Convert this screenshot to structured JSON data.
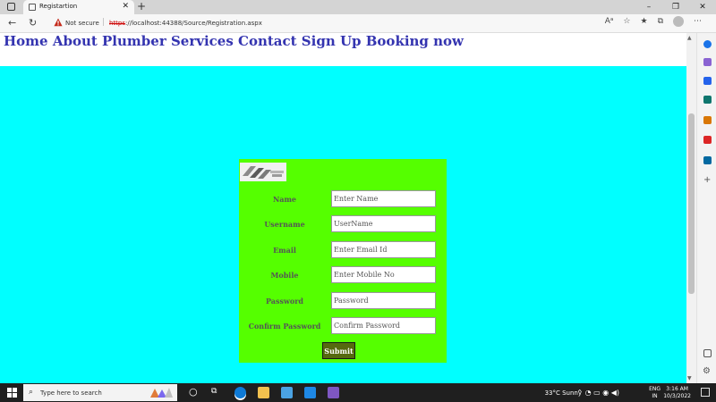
{
  "browser": {
    "tab_title": "Registartion",
    "new_tab_symbol": "+",
    "address": {
      "security_label": "Not secure",
      "protocol": "https",
      "url_rest": "://localhost:44388/Source/Registration.aspx"
    },
    "window_controls": {
      "minimize": "–",
      "maximize": "❐",
      "close": "✕"
    }
  },
  "page": {
    "nav_items": [
      "Home",
      "About",
      "Plumber Services",
      "Contact",
      "Sign Up",
      "Booking now"
    ],
    "form": {
      "fields": [
        {
          "label": "Name",
          "placeholder": "Enter Name"
        },
        {
          "label": "Username",
          "placeholder": "UserName"
        },
        {
          "label": "Email",
          "placeholder": "Enter Email Id"
        },
        {
          "label": "Mobile",
          "placeholder": "Enter Mobile No"
        },
        {
          "label": "Password",
          "placeholder": "Password"
        },
        {
          "label": "Confirm Password",
          "placeholder": "Confirm Password"
        }
      ],
      "submit_label": "Submit"
    }
  },
  "taskbar": {
    "search_placeholder": "Type here to search",
    "weather": "33°C  Sunny",
    "lang_top": "ENG",
    "lang_bottom": "IN",
    "time": "3:16 AM",
    "date": "10/3/2022"
  },
  "colors": {
    "page_background": "#00ffff",
    "form_background": "#55ff00",
    "nav_link": "#3434b0",
    "submit_button": "#56690f"
  }
}
